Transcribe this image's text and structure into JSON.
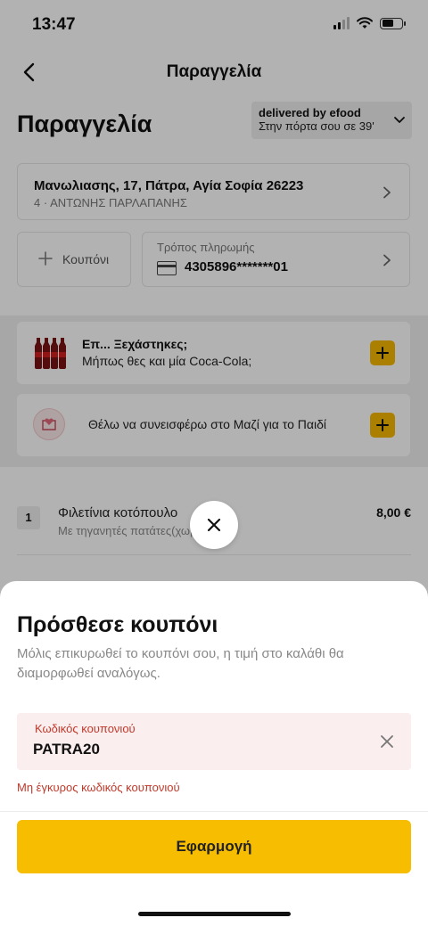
{
  "status_bar": {
    "time": "13:47"
  },
  "nav": {
    "title": "Παραγγελία"
  },
  "order": {
    "title": "Παραγγελία",
    "delivery_title": "delivered by efood",
    "delivery_sub": "Στην πόρτα σου σε 39'"
  },
  "address": {
    "main": "Μανωλιασης, 17, Πάτρα, Αγία Σοφία 26223",
    "sub": "4 · ΑΝΤΩΝΗΣ ΠΑΡΛΑΠΑΝΗΣ"
  },
  "coupon_card": {
    "label": "Κουπόνι"
  },
  "payment": {
    "label": "Τρόπος πληρωμής",
    "number": "4305896*******01"
  },
  "suggestions": {
    "cola_title": "Επ... Ξεχάστηκες;",
    "cola_sub": "Μήπως θες και μία Coca-Cola;",
    "donate_label": "Θέλω να συνεισφέρω στο Μαζί για το Παιδί"
  },
  "cart_item": {
    "qty": "1",
    "name": "Φιλετίνια κοτόπουλο",
    "description": "Με τηγανητές πατάτες(χωρίς...)",
    "price": "8,00 €"
  },
  "sheet": {
    "title": "Πρόσθεσε κουπόνι",
    "description": "Μόλις επικυρωθεί το κουπόνι σου, η τιμή στο καλάθι θα διαμορφωθεί αναλόγως.",
    "field_label": "Κωδικός κουπονιού",
    "field_value": "PATRA20",
    "error": "Μη έγκυρος κωδικός κουπονιού",
    "apply_label": "Εφαρμογή"
  },
  "colors": {
    "accent": "#f7bd00",
    "error": "#c0392b",
    "field_bg": "#fbeeee"
  }
}
